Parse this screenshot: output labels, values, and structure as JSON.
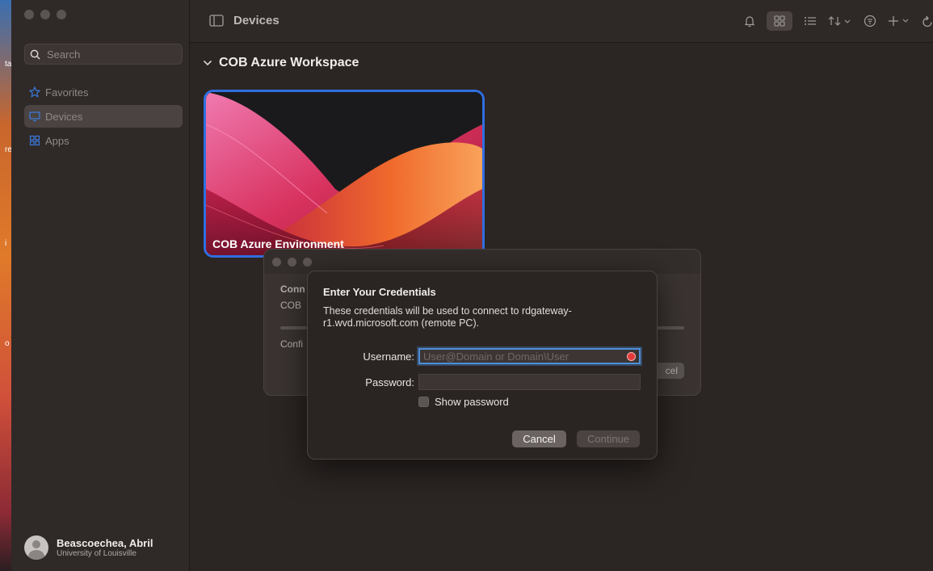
{
  "desktop": {
    "fragments": [
      "ta",
      "re",
      "i",
      "o"
    ]
  },
  "sidebar": {
    "search_placeholder": "Search",
    "items": [
      {
        "label": "Favorites",
        "icon": "star-icon",
        "active": false
      },
      {
        "label": "Devices",
        "icon": "monitor-icon",
        "active": true
      },
      {
        "label": "Apps",
        "icon": "apps-grid-icon",
        "active": false
      }
    ],
    "profile": {
      "name": "Beascoechea, Abril",
      "org": "University of Louisville"
    }
  },
  "toolbar": {
    "title": "Devices"
  },
  "content": {
    "group_title": "COB Azure Workspace",
    "tile_label": "COB Azure Environment"
  },
  "back_dialog": {
    "line1": "Conn",
    "line2": "COB",
    "line3": "Confi",
    "button_fragment": "cel"
  },
  "credentials_dialog": {
    "title": "Enter Your Credentials",
    "description": "These credentials will be used to connect to rdgateway-r1.wvd.microsoft.com (remote PC).",
    "username_label": "Username:",
    "username_placeholder": "User@Domain or Domain\\User",
    "username_value": "",
    "password_label": "Password:",
    "password_value": "",
    "show_password_label": "Show password",
    "cancel_label": "Cancel",
    "continue_label": "Continue"
  },
  "colors": {
    "accent": "#2f6fe0",
    "focus": "#4d8fd8",
    "error": "#e03a3a"
  }
}
